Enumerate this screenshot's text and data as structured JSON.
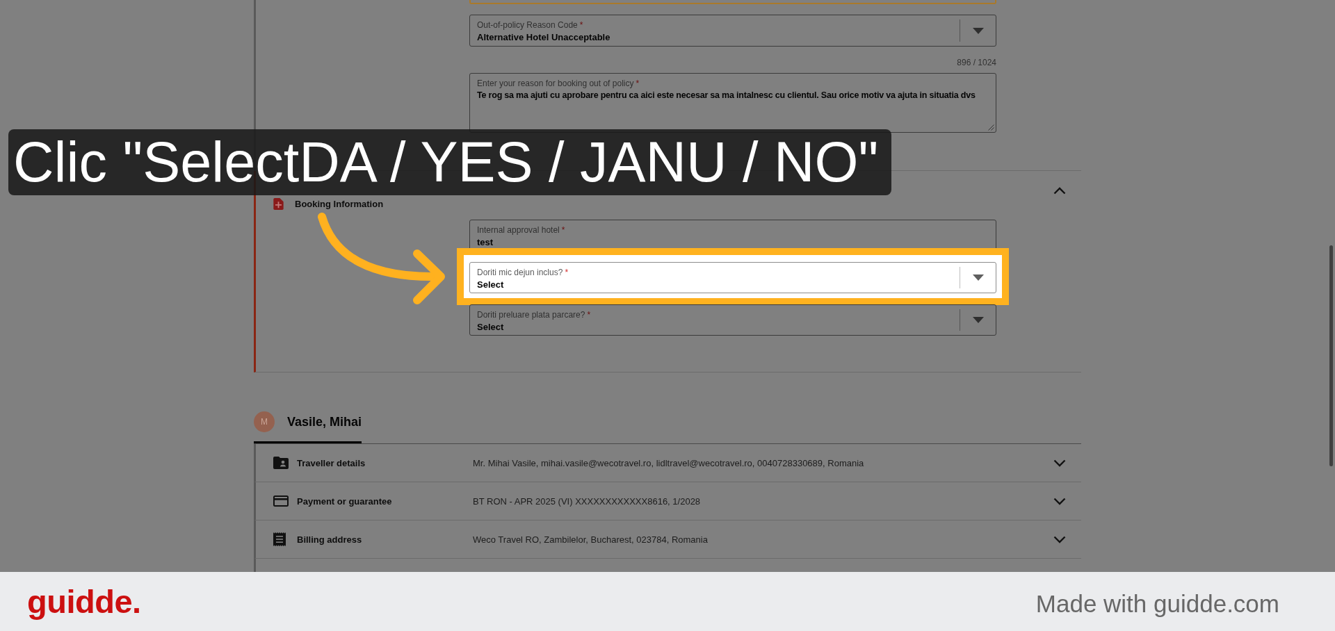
{
  "policy": {
    "reason_code": {
      "label": "Out-of-policy Reason Code",
      "required_mark": "*",
      "value": "Alternative Hotel Unacceptable"
    },
    "character_count": "896 / 1024",
    "reason": {
      "label": "Enter your reason for booking out of policy",
      "required_mark": "*",
      "value": "Te rog sa ma ajuti cu aprobare pentru ca aici este necesar sa ma intalnesc cu clientul. Sau orice motiv va ajuta in situatia dvs"
    }
  },
  "booking_information": {
    "title": "Booking Information",
    "expanded": true,
    "fields": [
      {
        "kind": "text",
        "label": "Internal approval hotel",
        "required_mark": "*",
        "value": "test",
        "highlighted": false
      },
      {
        "kind": "select",
        "label": "Doriti mic dejun inclus?",
        "required_mark": "*",
        "value": "Select",
        "highlighted": true
      },
      {
        "kind": "select",
        "label": "Doriti preluare plata parcare?",
        "required_mark": "*",
        "value": "Select",
        "highlighted": false
      }
    ]
  },
  "traveller": {
    "avatar_initial": "M",
    "name": "Vasile, Mihai",
    "selected": true,
    "sections": [
      {
        "kind": "traveller",
        "label": "Traveller details",
        "value": "Mr. Mihai Vasile, mihai.vasile@wecotravel.ro, lidltravel@wecotravel.ro, 0040728330689, Romania",
        "expanded": false
      },
      {
        "kind": "payment",
        "label": "Payment or guarantee",
        "value": "BT RON - APR 2025 (VI) XXXXXXXXXXXX8616, 1/2028",
        "expanded": false
      },
      {
        "kind": "billing",
        "label": "Billing address",
        "value": "Weco Travel RO, Zambilelor, Bucharest, 023784, Romania",
        "expanded": false
      }
    ]
  },
  "callout": {
    "text": "Clic \"SelectDA / YES / JANU / NO\""
  },
  "footer": {
    "logo": "guidde.",
    "credit": "Made with guidde.com"
  }
}
